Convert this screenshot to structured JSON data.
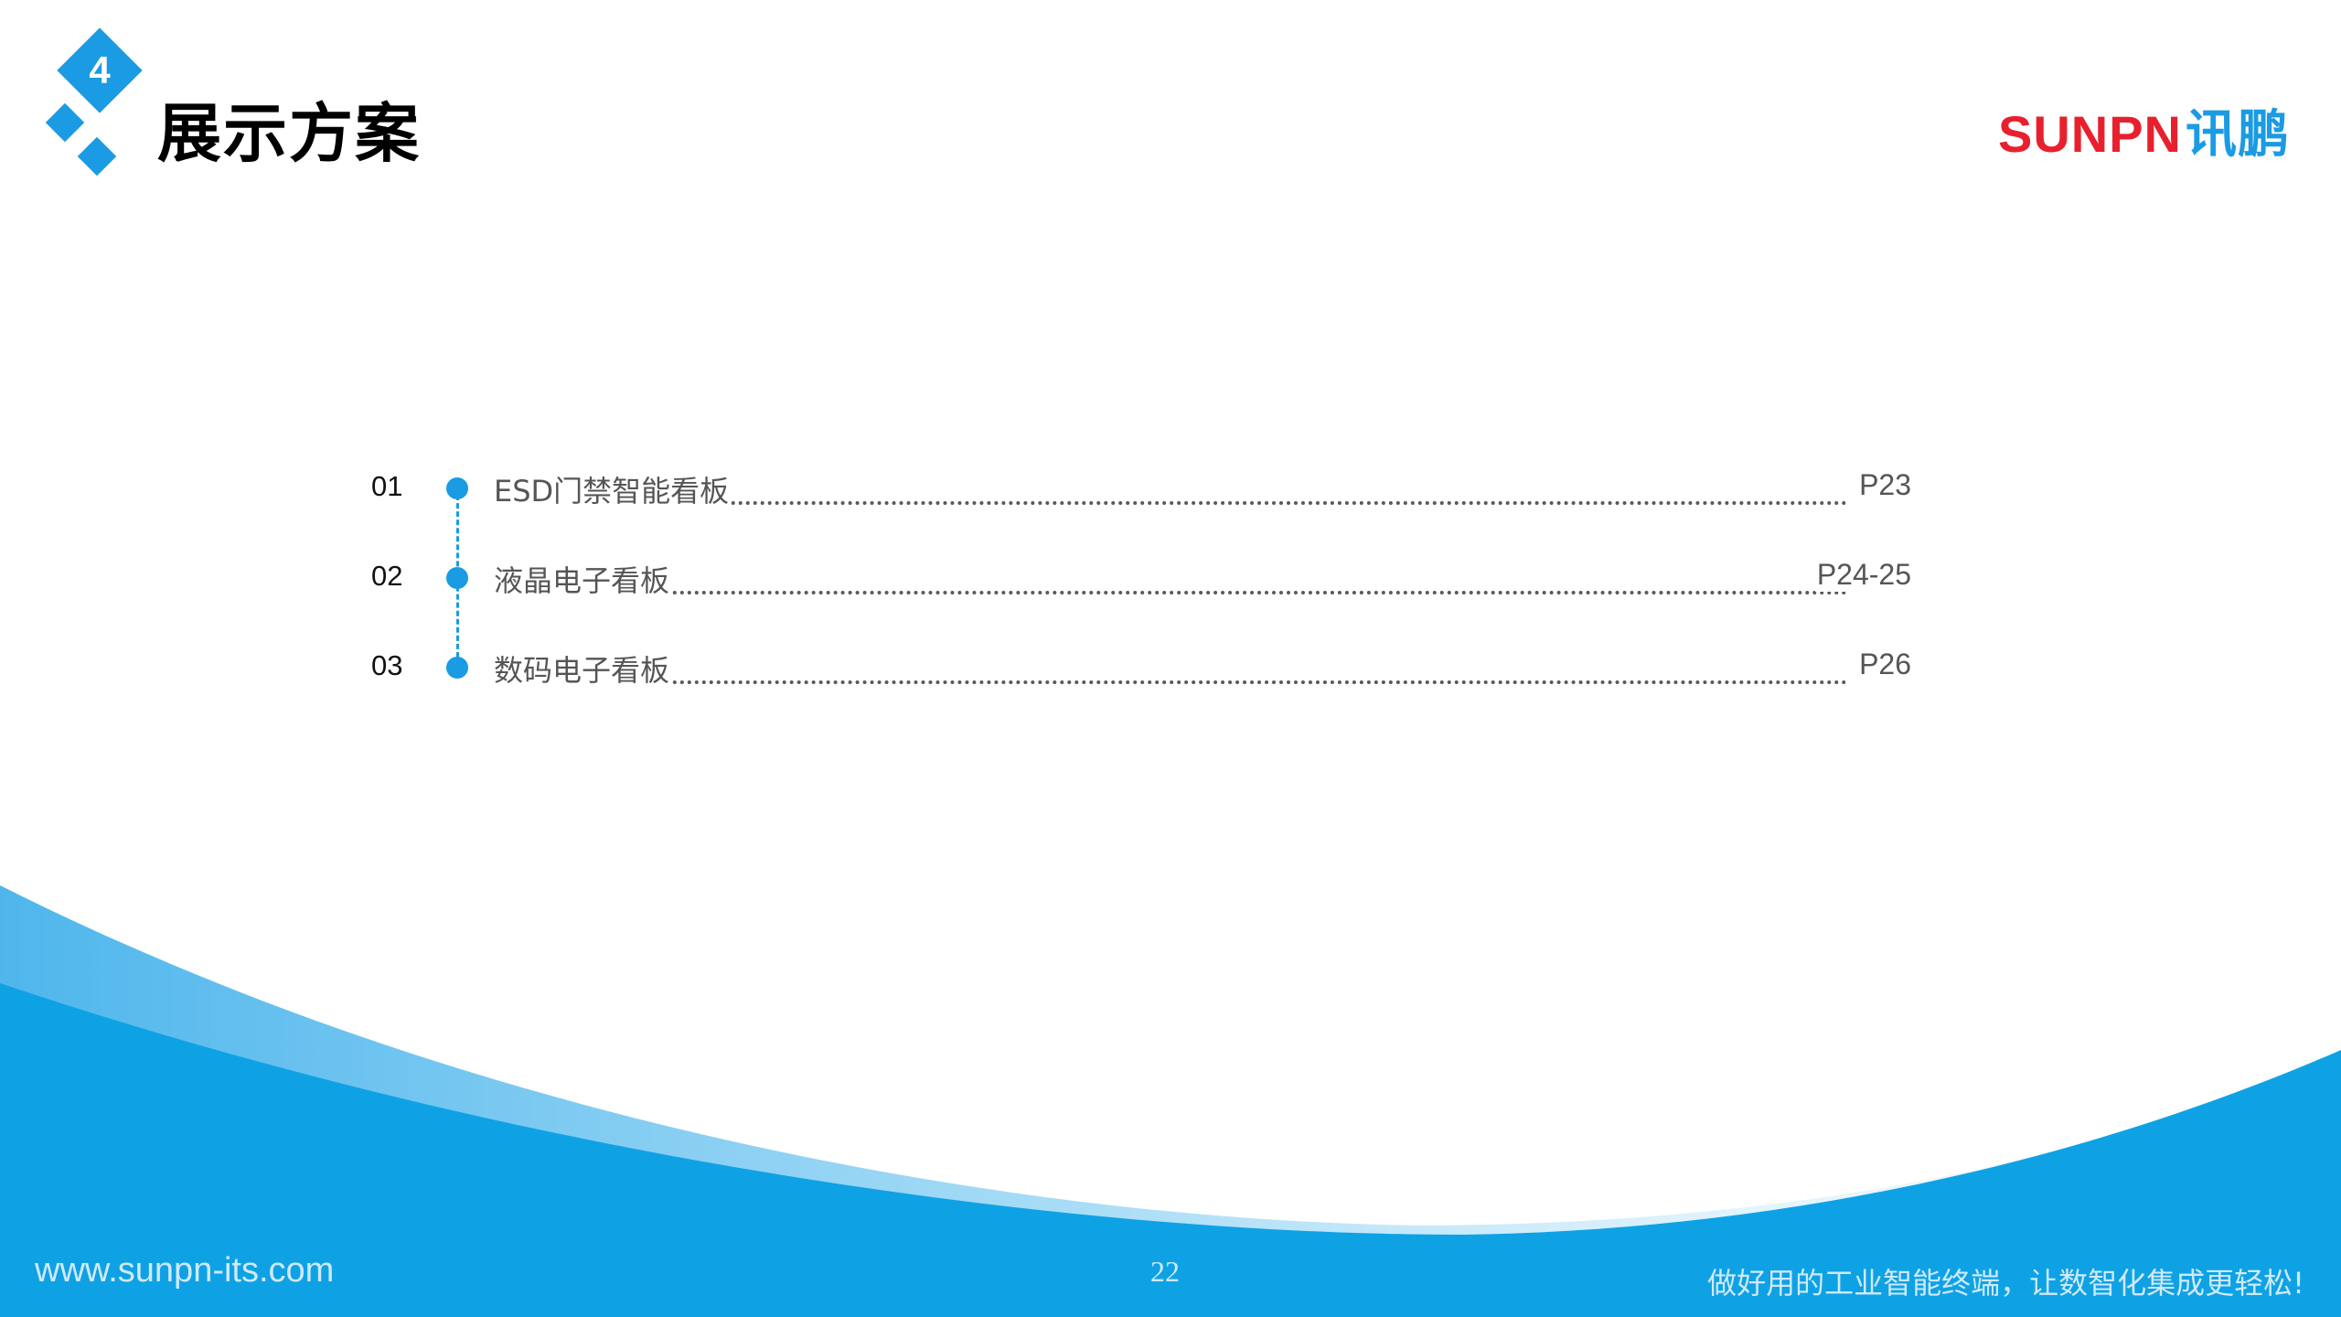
{
  "header": {
    "section_number": "4",
    "title": "展示方案",
    "brand_en": "SUNPN",
    "brand_cn": "讯鹏"
  },
  "toc": {
    "items": [
      {
        "num": "01",
        "label": "ESD门禁智能看板",
        "page": "P23"
      },
      {
        "num": "02",
        "label": "液晶电子看板",
        "page": "P24-25"
      },
      {
        "num": "03",
        "label": "数码电子看板",
        "page": "P26"
      }
    ]
  },
  "footer": {
    "url": "www.sunpn-its.com",
    "page_number": "22",
    "slogan": "做好用的工业智能终端，让数智化集成更轻松!"
  },
  "colors": {
    "accent": "#1a9be3",
    "brand_red": "#e8202e",
    "wave_light": "#8fd0f2",
    "text_gray": "#555555"
  }
}
